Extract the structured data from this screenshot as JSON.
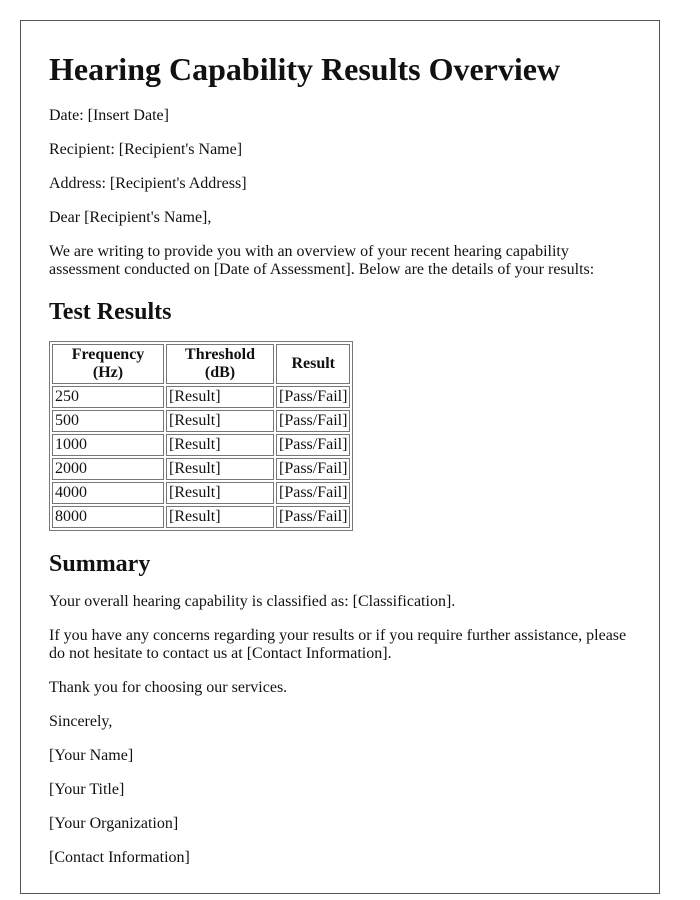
{
  "title": "Hearing Capability Results Overview",
  "header_lines": {
    "date": "Date: [Insert Date]",
    "recipient": "Recipient: [Recipient's Name]",
    "address": "Address: [Recipient's Address]"
  },
  "salutation": "Dear [Recipient's Name],",
  "intro": "We are writing to provide you with an overview of your recent hearing capability assessment conducted on [Date of Assessment]. Below are the details of your results:",
  "test_results": {
    "heading": "Test Results",
    "columns": [
      "Frequency (Hz)",
      "Threshold (dB)",
      "Result"
    ],
    "rows": [
      [
        "250",
        "[Result]",
        "[Pass/Fail]"
      ],
      [
        "500",
        "[Result]",
        "[Pass/Fail]"
      ],
      [
        "1000",
        "[Result]",
        "[Pass/Fail]"
      ],
      [
        "2000",
        "[Result]",
        "[Pass/Fail]"
      ],
      [
        "4000",
        "[Result]",
        "[Pass/Fail]"
      ],
      [
        "8000",
        "[Result]",
        "[Pass/Fail]"
      ]
    ]
  },
  "summary": {
    "heading": "Summary",
    "classification": "Your overall hearing capability is classified as: [Classification].",
    "concerns": "If you have any concerns regarding your results or if you require further assistance, please do not hesitate to contact us at [Contact Information].",
    "thanks": "Thank you for choosing our services."
  },
  "closing": {
    "signoff": "Sincerely,",
    "name": "[Your Name]",
    "title": "[Your Title]",
    "organization": "[Your Organization]",
    "contact": "[Contact Information]"
  }
}
